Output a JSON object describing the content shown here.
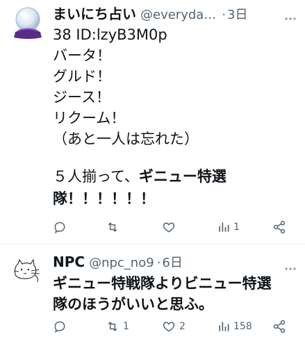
{
  "tweets": [
    {
      "display_name": "まいにち占い",
      "handle": "@everyda…",
      "separator": "·",
      "time": "3日",
      "lines": [
        "38 ID:lzyB3M0p",
        "バータ！",
        "グルド！",
        "ジース！",
        "リクーム！",
        "（あと一人は忘れた）",
        "",
        "５人揃って、",
        "ギニュー特選",
        "隊！！！！！！"
      ],
      "actions": {
        "reply": "",
        "retweet": "",
        "like": "",
        "views": "1"
      }
    },
    {
      "display_name": "NPC",
      "handle": "@npc_no9",
      "separator": "·",
      "time": "6日",
      "lines": [
        "ギニュー特戦隊よりビニュー特選",
        "隊のほうがいいと思ふ。"
      ],
      "actions": {
        "reply": "",
        "retweet": "1",
        "like": "2",
        "views": "158"
      }
    }
  ],
  "icons": [
    "crystal-ball-avatar",
    "cat-sketch-avatar",
    "more-icon",
    "reply-icon",
    "retweet-icon",
    "like-icon",
    "views-icon",
    "share-icon"
  ],
  "colors": {
    "text": "#0f1419",
    "muted": "#536471",
    "divider": "#eff3f4"
  }
}
